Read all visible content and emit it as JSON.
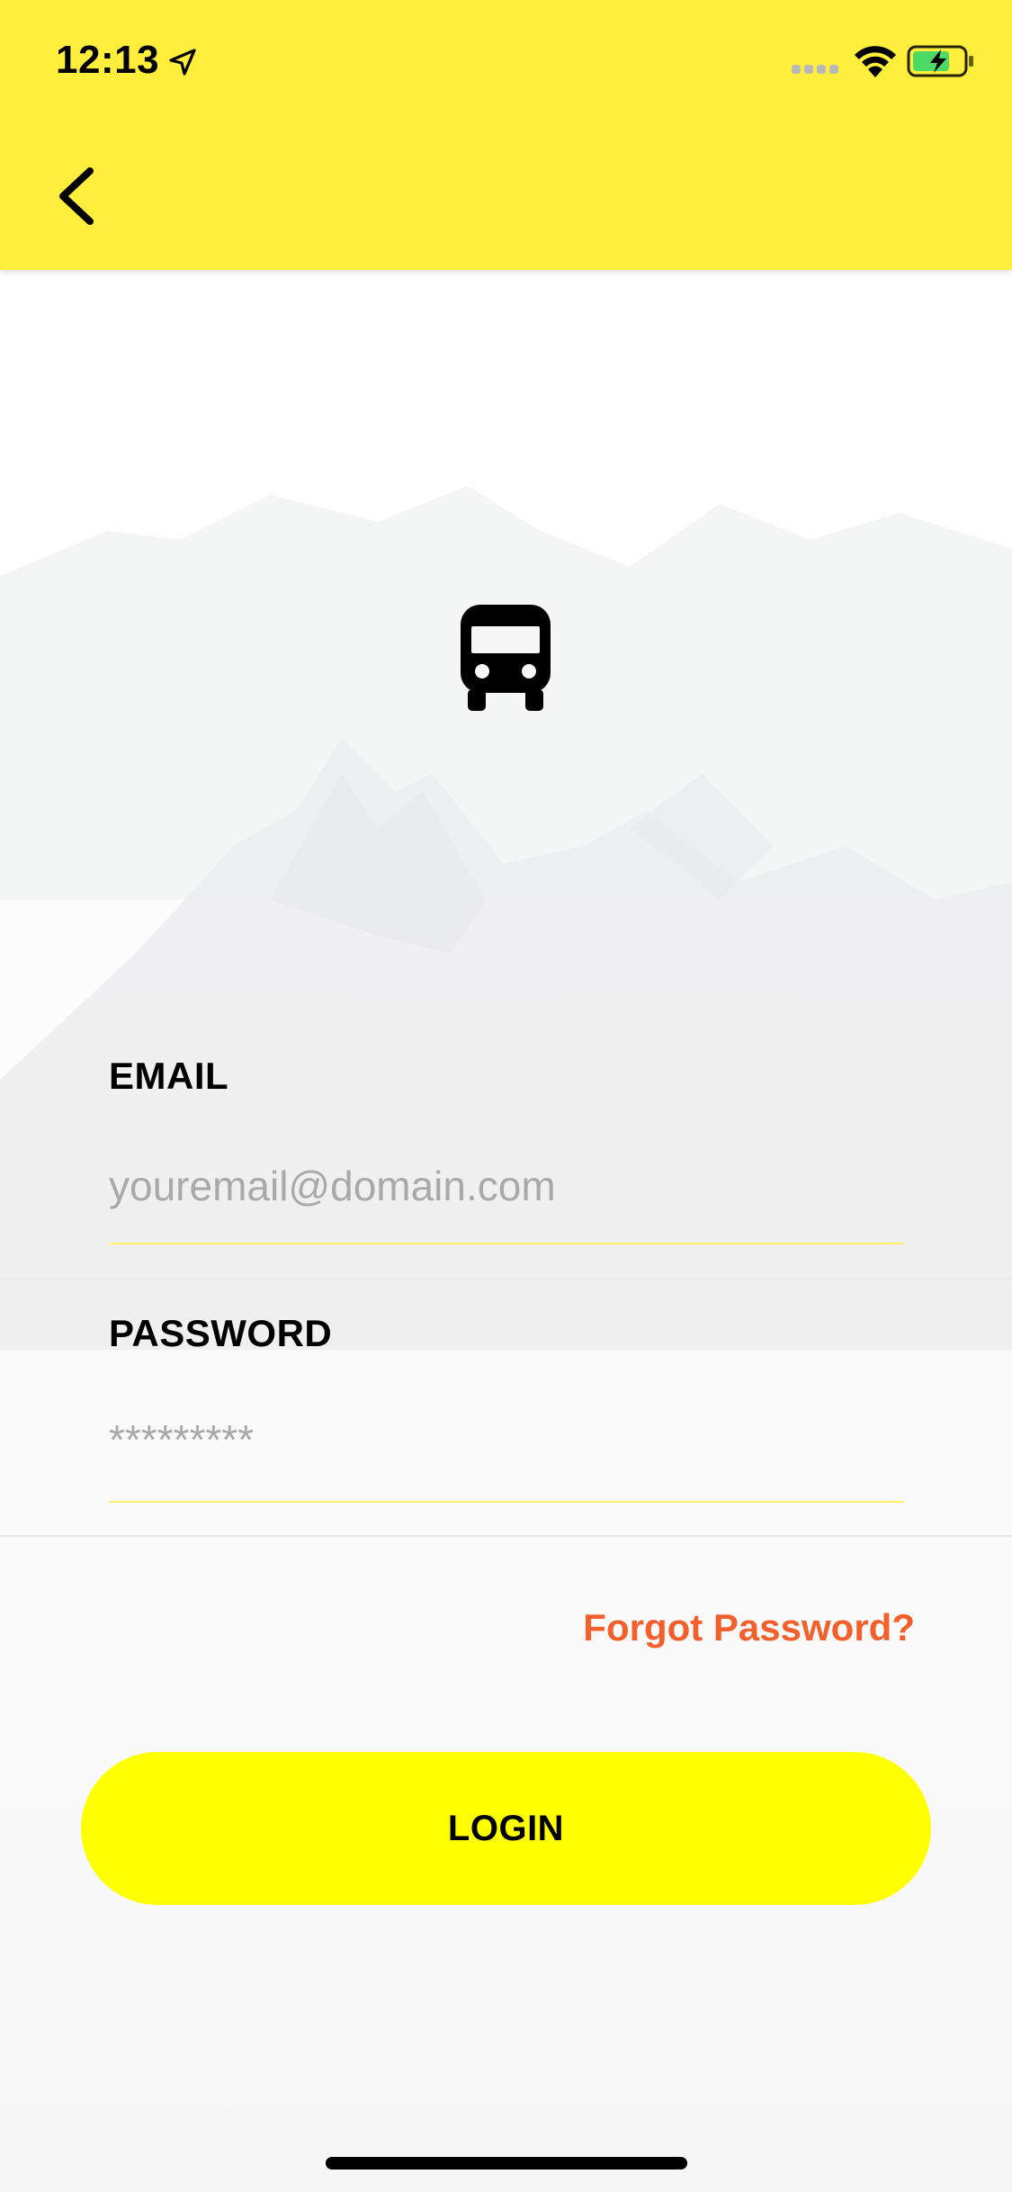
{
  "status_bar": {
    "time": "12:13",
    "icons": [
      "location-arrow-icon",
      "cellular-signal-icon",
      "wifi-icon",
      "battery-charging-icon"
    ]
  },
  "header": {
    "background_color": "#ffee3b",
    "back_icon": "chevron-left-icon"
  },
  "logo": {
    "icon": "bus-icon"
  },
  "form": {
    "email": {
      "label": "EMAIL",
      "placeholder": "youremail@domain.com",
      "value": ""
    },
    "password": {
      "label": "PASSWORD",
      "placeholder": "*********",
      "value": ""
    },
    "forgot_label": "Forgot Password?",
    "forgot_color": "#f4602c",
    "login_label": "LOGIN",
    "login_color": "#ffff00"
  }
}
